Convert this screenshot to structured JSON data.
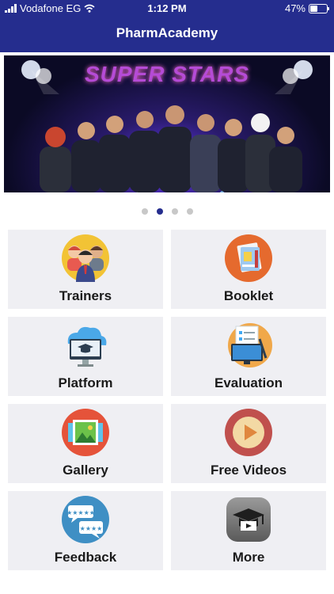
{
  "status_bar": {
    "carrier": "Vodafone EG",
    "time": "1:12 PM",
    "battery_percent": "47%"
  },
  "header": {
    "title": "PharmAcademy"
  },
  "banner": {
    "headline": "SUPER STARS"
  },
  "carousel": {
    "count": 4,
    "active_index": 1
  },
  "tiles": [
    {
      "label": "Trainers",
      "icon": "trainers-icon"
    },
    {
      "label": "Booklet",
      "icon": "booklet-icon"
    },
    {
      "label": "Platform",
      "icon": "platform-icon"
    },
    {
      "label": "Evaluation",
      "icon": "evaluation-icon"
    },
    {
      "label": "Gallery",
      "icon": "gallery-icon"
    },
    {
      "label": "Free Videos",
      "icon": "free-videos-icon"
    },
    {
      "label": "Feedback",
      "icon": "feedback-icon"
    },
    {
      "label": "More",
      "icon": "more-icon"
    }
  ],
  "colors": {
    "header_bg": "#252d8e",
    "tile_bg": "#efeff3",
    "active_dot": "#252d8e"
  }
}
